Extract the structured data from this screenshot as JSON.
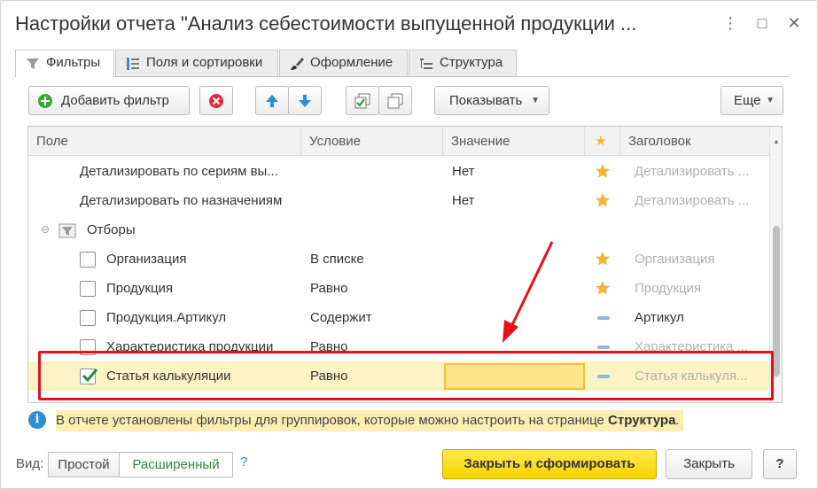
{
  "window": {
    "title": "Настройки отчета \"Анализ себестоимости выпущенной продукции ...",
    "controls": {
      "menu": "⋮",
      "maximize": "□",
      "close": "✕"
    }
  },
  "tabs": [
    {
      "label": "Фильтры",
      "icon": "filter-icon",
      "active": true
    },
    {
      "label": "Поля и сортировки",
      "icon": "fields-icon",
      "active": false
    },
    {
      "label": "Оформление",
      "icon": "brush-icon",
      "active": false
    },
    {
      "label": "Структура",
      "icon": "structure-icon",
      "active": false
    }
  ],
  "toolbar": {
    "add_filter": "Добавить фильтр",
    "show": "Показывать",
    "more": "Еще"
  },
  "table": {
    "columns": {
      "field": "Поле",
      "condition": "Условие",
      "value": "Значение",
      "star": "★",
      "caption": "Заголовок"
    },
    "rows": [
      {
        "field": "Детализировать по сериям вы...",
        "condition": "",
        "value": "Нет",
        "mark": "star",
        "caption": "Детализировать ...",
        "checkbox": "none",
        "caption_grey": true
      },
      {
        "field": "Детализировать по назначениям",
        "condition": "",
        "value": "Нет",
        "mark": "star",
        "caption": "Детализировать ...",
        "checkbox": "none",
        "caption_grey": true
      },
      {
        "field": "Отборы",
        "condition": "",
        "value": "",
        "mark": "",
        "caption": "",
        "checkbox": "group"
      },
      {
        "field": "Организация",
        "condition": "В списке",
        "value": "",
        "mark": "star",
        "caption": "Организация",
        "checkbox": "unchecked",
        "caption_grey": true
      },
      {
        "field": "Продукция",
        "condition": "Равно",
        "value": "",
        "mark": "star",
        "caption": "Продукция",
        "checkbox": "unchecked",
        "caption_grey": true
      },
      {
        "field": "Продукция.Артикул",
        "condition": "Содержит",
        "value": "",
        "mark": "dash",
        "caption": "Артикул",
        "checkbox": "unchecked",
        "caption_grey": false
      },
      {
        "field": "Характеристика продукции",
        "condition": "Равно",
        "value": "",
        "mark": "dash",
        "caption": "Характеристика ...",
        "checkbox": "unchecked",
        "caption_grey": true
      },
      {
        "field": "Статья калькуляции",
        "condition": "Равно",
        "value": "",
        "mark": "dash",
        "caption": "Статья калькуля...",
        "checkbox": "checked",
        "caption_grey": true,
        "highlighted": true
      }
    ]
  },
  "info": {
    "text": "В отчете установлены фильтры для группировок, которые можно настроить на странице ",
    "link": "Структура",
    "suffix": "."
  },
  "footer": {
    "view_label": "Вид:",
    "simple": "Простой",
    "extended": "Расширенный",
    "help": "?",
    "close_and_build": "Закрыть и сформировать",
    "close": "Закрыть",
    "help_button": "?"
  },
  "colors": {
    "accent_yellow": "#f7d300",
    "annotation_red": "#e8101a",
    "star": "#f5b335",
    "info_blue": "#2a8fd6",
    "extended_green": "#2d8a3e"
  }
}
